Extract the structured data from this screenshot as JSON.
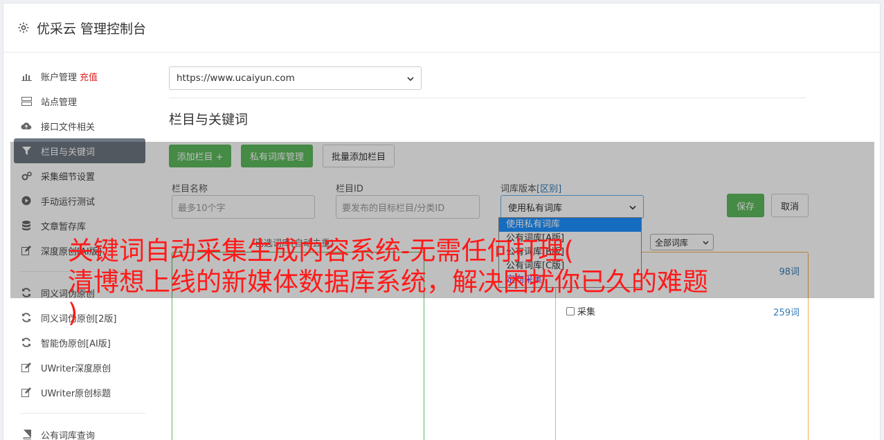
{
  "header": {
    "title": "优采云 管理控制台"
  },
  "sidebar": {
    "items": [
      {
        "label": "账户管理",
        "extra": "充值",
        "icon": "bar-chart-icon"
      },
      {
        "label": "站点管理",
        "icon": "server-icon"
      },
      {
        "label": "接口文件相关",
        "icon": "cloud-upload-icon"
      },
      {
        "label": "栏目与关键词",
        "icon": "filter-icon",
        "active": true
      },
      {
        "label": "采集细节设置",
        "icon": "gears-icon"
      },
      {
        "label": "手动运行测试",
        "icon": "play-circle-icon"
      },
      {
        "label": "文章暂存库",
        "icon": "database-icon"
      },
      {
        "label": "深度原创[AI版]",
        "icon": "edit-icon"
      },
      {
        "label": "同义词伪原创",
        "icon": "refresh-icon"
      },
      {
        "label": "同义词伪原创[2版]",
        "icon": "refresh-icon"
      },
      {
        "label": "智能伪原创[AI版]",
        "icon": "refresh-icon"
      },
      {
        "label": "UWriter深度原创",
        "icon": "edit-icon"
      },
      {
        "label": "UWriter原创标题",
        "icon": "edit-icon"
      },
      {
        "label": "公有词库查询",
        "icon": "book-icon"
      }
    ]
  },
  "main": {
    "site_select": "https://www.ucaiyun.com",
    "section_title": "栏目与关键词",
    "buttons": {
      "add_column": "添加栏目 +",
      "private_lib": "私有词库管理",
      "batch_add": "批量添加栏目"
    },
    "form": {
      "column_name_label": "栏目名称",
      "column_name_placeholder": "最多10个字",
      "column_id_label": "栏目ID",
      "column_id_placeholder": "要发布的目标栏目/分类ID",
      "lib_version_label": "词库版本",
      "lib_version_link": "[区别]",
      "lib_version_value": "使用私有词库",
      "save": "保存",
      "cancel": "取消"
    },
    "dropdown_options": [
      "使用私有词库",
      "公有词库[A版]",
      "公有词库[B版]",
      "公有词库[C版]",
      "定向采集"
    ],
    "selected_words_label": "已选词库(自动去重)",
    "lib_filter": "全部词库",
    "libraries": [
      {
        "name": "采集",
        "count": "98词"
      },
      {
        "name": "采集",
        "count": "259词"
      }
    ]
  },
  "caption": {
    "line1": "关键词自动采集生成内容系统-无需任何打理(",
    "line2": "清博想上线的新媒体数据库系统，解决困扰你已久的难题",
    "line3": ")"
  }
}
